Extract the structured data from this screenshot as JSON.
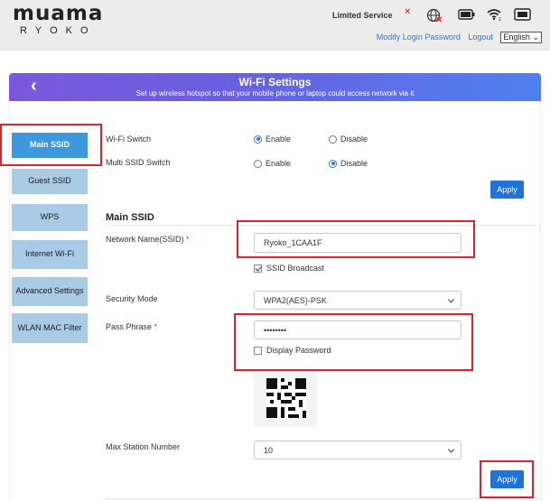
{
  "header": {
    "logo": "muama",
    "logo_sub": "RYOKO",
    "status": "Limited Service",
    "links": [
      "Modify Login Password",
      "Logout"
    ],
    "language": "English"
  },
  "banner": {
    "title": "Wi-Fi Settings",
    "subtitle": "Set up wireless hotspot so that your mobile phone or laptop could access network via it"
  },
  "sidebar": {
    "items": [
      {
        "label": "Main SSID"
      },
      {
        "label": "Guest SSID"
      },
      {
        "label": "WPS"
      },
      {
        "label": "Internet Wi-Fi"
      },
      {
        "label": "Advanced Settings"
      },
      {
        "label": "WLAN MAC Filter"
      }
    ]
  },
  "switches": {
    "wifi_label": "Wi-Fi Switch",
    "multi_label": "Multi SSID Switch",
    "enable": "Enable",
    "disable": "Disable",
    "wifi_value": "Enable",
    "multi_value": "Disable",
    "apply": "Apply"
  },
  "main_ssid": {
    "title": "Main SSID",
    "name_label": "Network Name(SSID)",
    "name_value": "Ryoko_1CAA1F",
    "broadcast_label": "SSID Broadcast",
    "security_label": "Security Mode",
    "security_value": "WPA2(AES)-PSK",
    "pass_label": "Pass Phrase",
    "pass_value": "••••••••",
    "display_pw_label": "Display Password",
    "max_label": "Max Station Number",
    "max_value": "10",
    "apply": "Apply",
    "required_mark": "*"
  },
  "colors": {
    "accent": "#1f73d8",
    "sidebar_active": "#3f97de",
    "sidebar_inactive": "#aacbe6",
    "highlight": "#d9232d"
  },
  "icons": [
    "close-x-icon",
    "globe-blocked-icon",
    "battery-icon",
    "wifi-icon",
    "sim-card-icon",
    "back-chevron-icon",
    "qr-code-icon"
  ]
}
